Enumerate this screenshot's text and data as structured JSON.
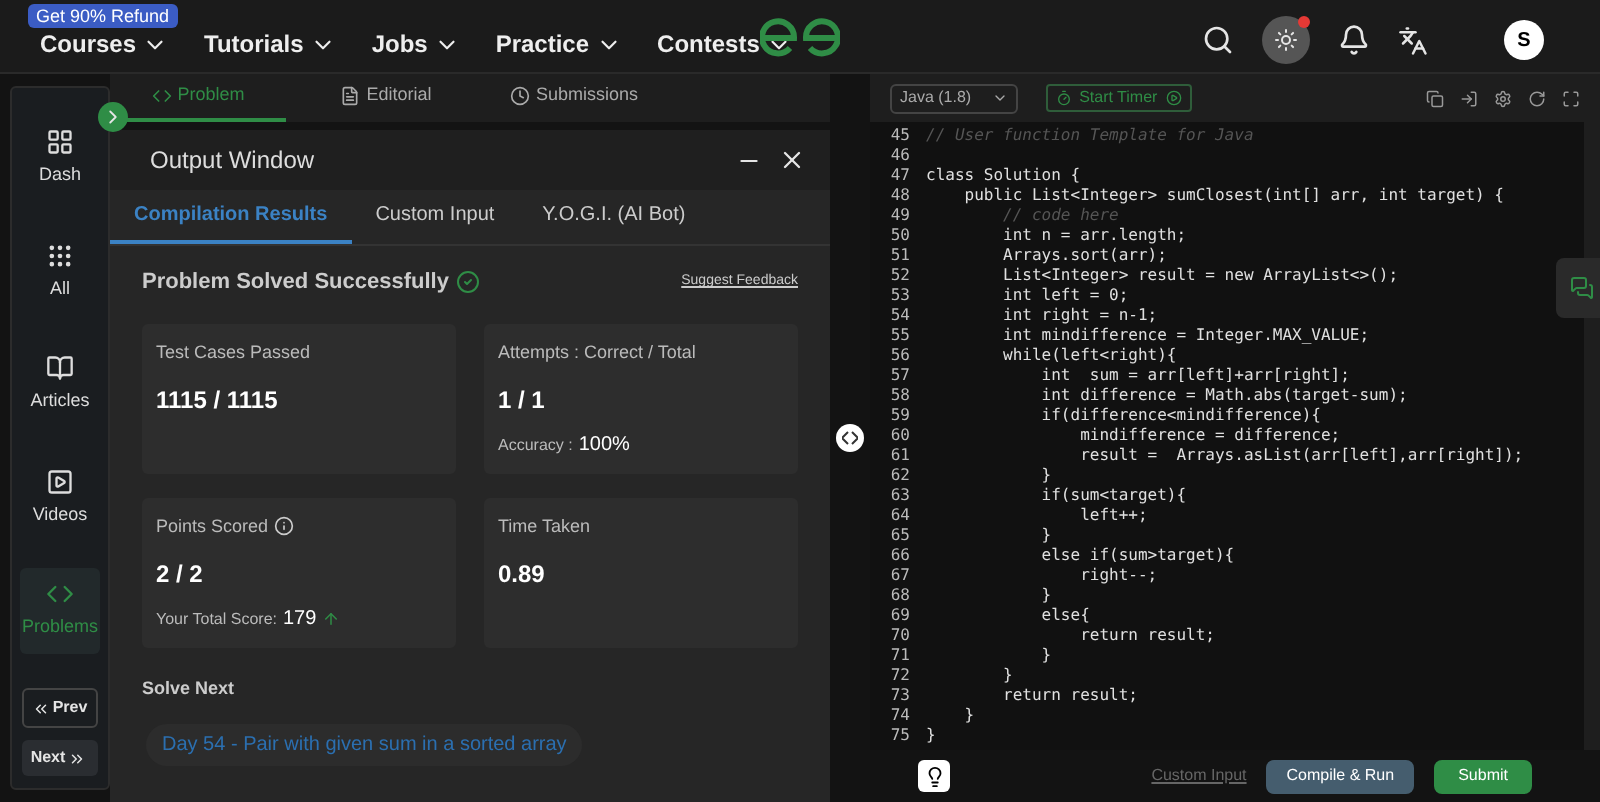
{
  "nav": {
    "badge": "Get 90% Refund",
    "menus": [
      "Courses",
      "Tutorials",
      "Jobs",
      "Practice",
      "Contests"
    ],
    "avatar": "S",
    "notification_dot": true
  },
  "sidebar": {
    "items": [
      {
        "label": "Dash",
        "selected": false
      },
      {
        "label": "All",
        "selected": false
      },
      {
        "label": "Articles",
        "selected": false
      },
      {
        "label": "Videos",
        "selected": false
      },
      {
        "label": "Problems",
        "selected": true
      }
    ],
    "prev": "Prev",
    "next": "Next"
  },
  "problem_tabs": [
    {
      "label": "Problem",
      "selected": true
    },
    {
      "label": "Editorial",
      "selected": false
    },
    {
      "label": "Submissions",
      "selected": false
    }
  ],
  "output_window": {
    "title": "Output Window",
    "tabs": [
      {
        "label": "Compilation Results",
        "selected": true
      },
      {
        "label": "Custom Input",
        "selected": false
      },
      {
        "label": "Y.O.G.I. (AI Bot)",
        "selected": false
      }
    ],
    "status": "Problem Solved Successfully",
    "feedback_link": "Suggest Feedback",
    "cards": [
      {
        "title": "Test Cases Passed",
        "value": "1115 / 1115"
      },
      {
        "title": "Attempts : Correct / Total",
        "value": "1 / 1",
        "note_label": "Accuracy :",
        "note_value": "100%"
      },
      {
        "title": "Points Scored",
        "value": "2 / 2",
        "info": true,
        "note_label": "Your Total Score:",
        "note_value": "179",
        "trend_up": true
      },
      {
        "title": "Time Taken",
        "value": "0.89"
      }
    ],
    "solve_next_heading": "Solve Next",
    "solve_next_link": "Day 54 - Pair with given sum in a sorted array"
  },
  "editor": {
    "language": "Java (1.8)",
    "timer_button": "Start Timer",
    "lines": [
      {
        "n": "45",
        "text": "// User function Template for Java",
        "kind": "comment"
      },
      {
        "n": "46",
        "kind": "blank"
      },
      {
        "n": "47",
        "text": "class Solution {",
        "kind": "code"
      },
      {
        "n": "48",
        "text": "    public List<Integer> sumClosest(int[] arr, int target) {",
        "kind": "code"
      },
      {
        "n": "49",
        "text": "        // code here",
        "kind": "comment"
      },
      {
        "n": "50",
        "text": "        int n = arr.length;",
        "kind": "code"
      },
      {
        "n": "51",
        "text": "        Arrays.sort(arr);",
        "kind": "code"
      },
      {
        "n": "52",
        "text": "        List<Integer> result = new ArrayList<>();",
        "kind": "code"
      },
      {
        "n": "53",
        "text": "        int left = 0;",
        "kind": "code"
      },
      {
        "n": "54",
        "text": "        int right = n-1;",
        "kind": "code"
      },
      {
        "n": "55",
        "text": "        int mindifference = Integer.MAX_VALUE;",
        "kind": "code"
      },
      {
        "n": "56",
        "text": "        while(left<right){",
        "kind": "code"
      },
      {
        "n": "57",
        "text": "            int  sum = arr[left]+arr[right];",
        "kind": "code"
      },
      {
        "n": "58",
        "text": "            int difference = Math.abs(target-sum);",
        "kind": "code"
      },
      {
        "n": "59",
        "text": "            if(difference<mindifference){",
        "kind": "code"
      },
      {
        "n": "60",
        "text": "                mindifference = difference;",
        "kind": "code"
      },
      {
        "n": "61",
        "text": "                result =  Arrays.asList(arr[left],arr[right]);",
        "kind": "code"
      },
      {
        "n": "62",
        "text": "            }",
        "kind": "code"
      },
      {
        "n": "63",
        "text": "            if(sum<target){",
        "kind": "code"
      },
      {
        "n": "64",
        "text": "                left++;",
        "kind": "code"
      },
      {
        "n": "65",
        "text": "            }",
        "kind": "code"
      },
      {
        "n": "66",
        "text": "            else if(sum>target){",
        "kind": "code"
      },
      {
        "n": "67",
        "text": "                right--;",
        "kind": "code"
      },
      {
        "n": "68",
        "text": "            }",
        "kind": "code"
      },
      {
        "n": "69",
        "text": "            else{",
        "kind": "code"
      },
      {
        "n": "70",
        "text": "                return result;",
        "kind": "code"
      },
      {
        "n": "71",
        "text": "            }",
        "kind": "code"
      },
      {
        "n": "72",
        "text": "        }",
        "kind": "code"
      },
      {
        "n": "73",
        "text": "        return result;",
        "kind": "code"
      },
      {
        "n": "74",
        "text": "    }",
        "kind": "code"
      },
      {
        "n": "75",
        "text": "}",
        "kind": "code"
      }
    ],
    "custom_input": "Custom Input",
    "compile_button": "Compile & Run",
    "submit_button": "Submit"
  }
}
